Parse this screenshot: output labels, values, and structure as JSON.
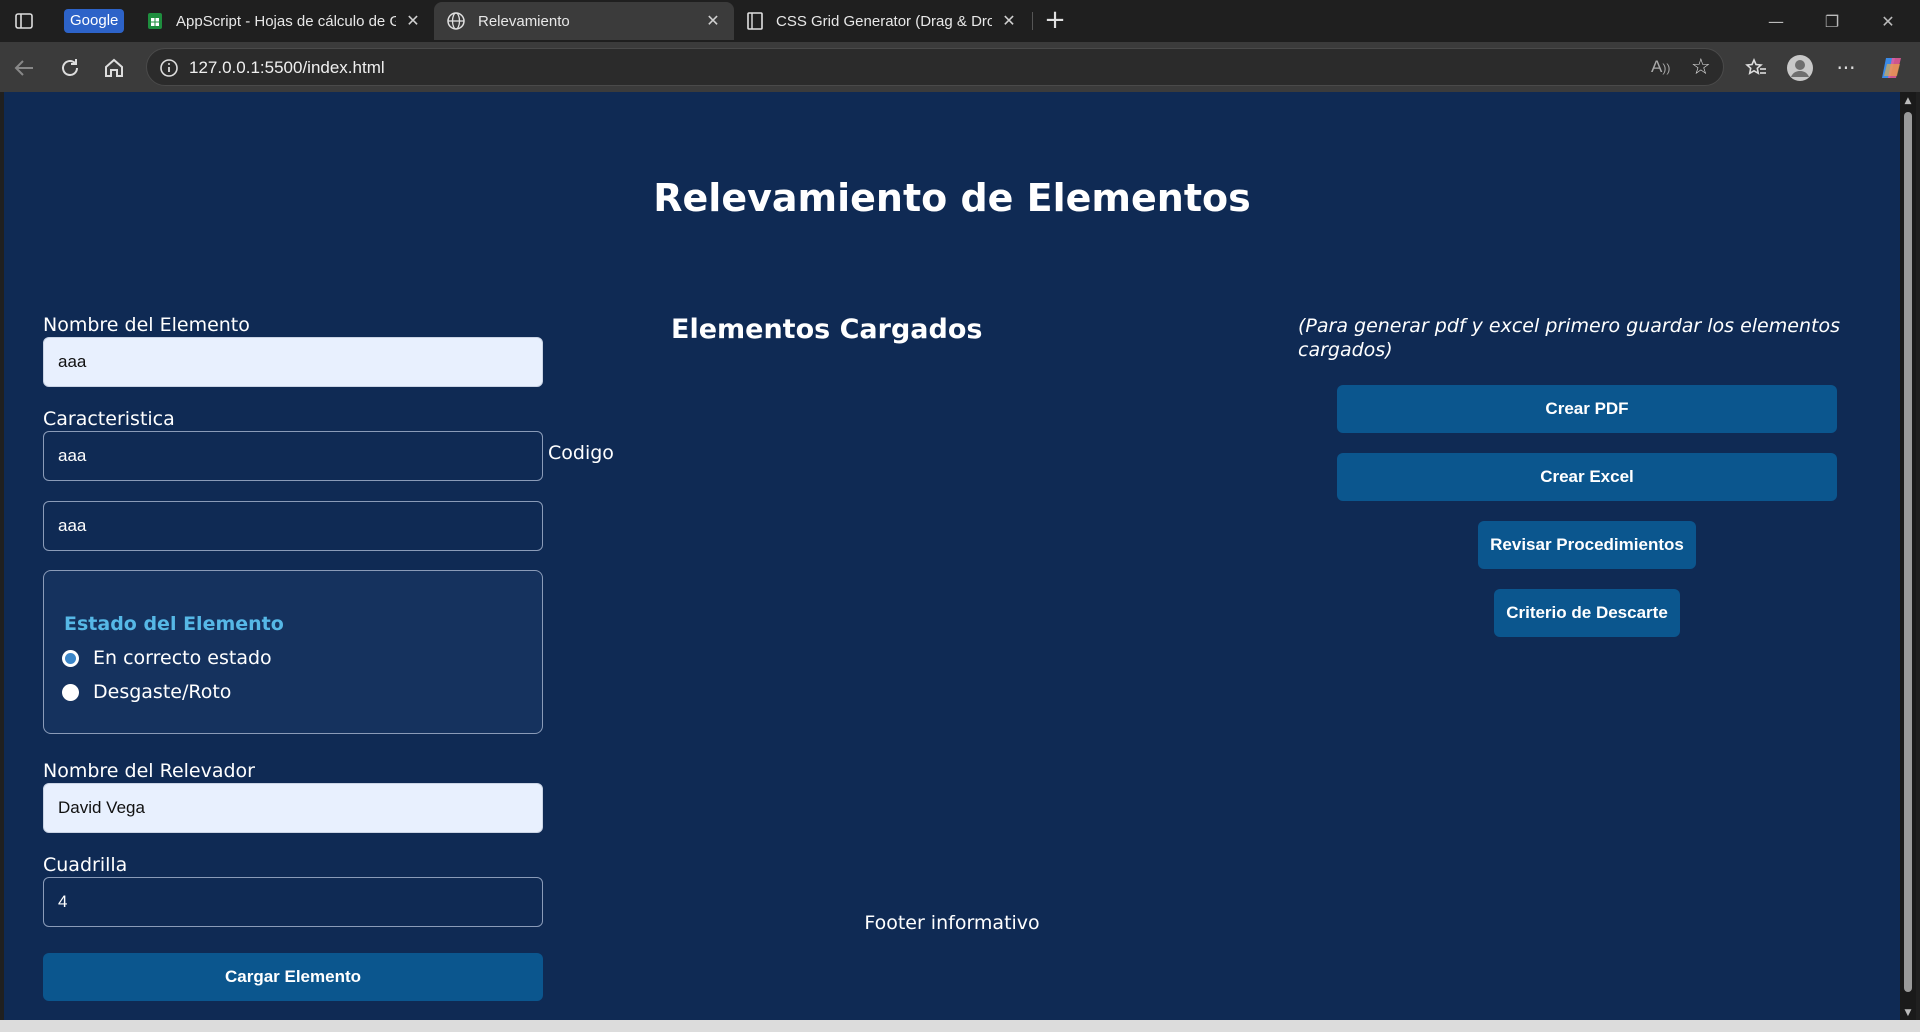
{
  "browser": {
    "tabs": [
      {
        "label": "Google",
        "kind": "badge"
      },
      {
        "label": "AppScript - Hojas de cálculo de G",
        "active": false
      },
      {
        "label": "Relevamiento",
        "active": true
      },
      {
        "label": "CSS Grid Generator (Drag & Drop",
        "active": false
      }
    ],
    "url": "127.0.0.1:5500/index.html",
    "accent": "#2d63c8"
  },
  "page": {
    "title": "Relevamiento de Elementos",
    "form": {
      "nombre_label": "Nombre del Elemento",
      "nombre_value": "aaa",
      "caracteristica_label": "Caracteristica",
      "caracteristica_value": "aaa",
      "codigo_label": "Codigo",
      "codigo_value": "aaa",
      "estado_legend": "Estado del Elemento",
      "estado_options": [
        "En correcto estado",
        "Desgaste/Roto"
      ],
      "estado_selected": "En correcto estado",
      "relevador_label": "Nombre del Relevador",
      "relevador_value": "David Vega",
      "cuadrilla_label": "Cuadrilla",
      "cuadrilla_value": "4",
      "submit_label": "Cargar Elemento"
    },
    "list_title": "Elementos Cargados",
    "note": "(Para generar pdf y excel primero guardar los elementos cargados)",
    "actions": {
      "pdf": "Crear PDF",
      "excel": "Crear Excel",
      "procedimientos": "Revisar Procedimientos",
      "descarte": "Criterio de Descarte"
    },
    "footer": "Footer informativo",
    "colors": {
      "background": "#0f2a54",
      "button": "#0b568e",
      "legend": "#56b8e6"
    }
  }
}
